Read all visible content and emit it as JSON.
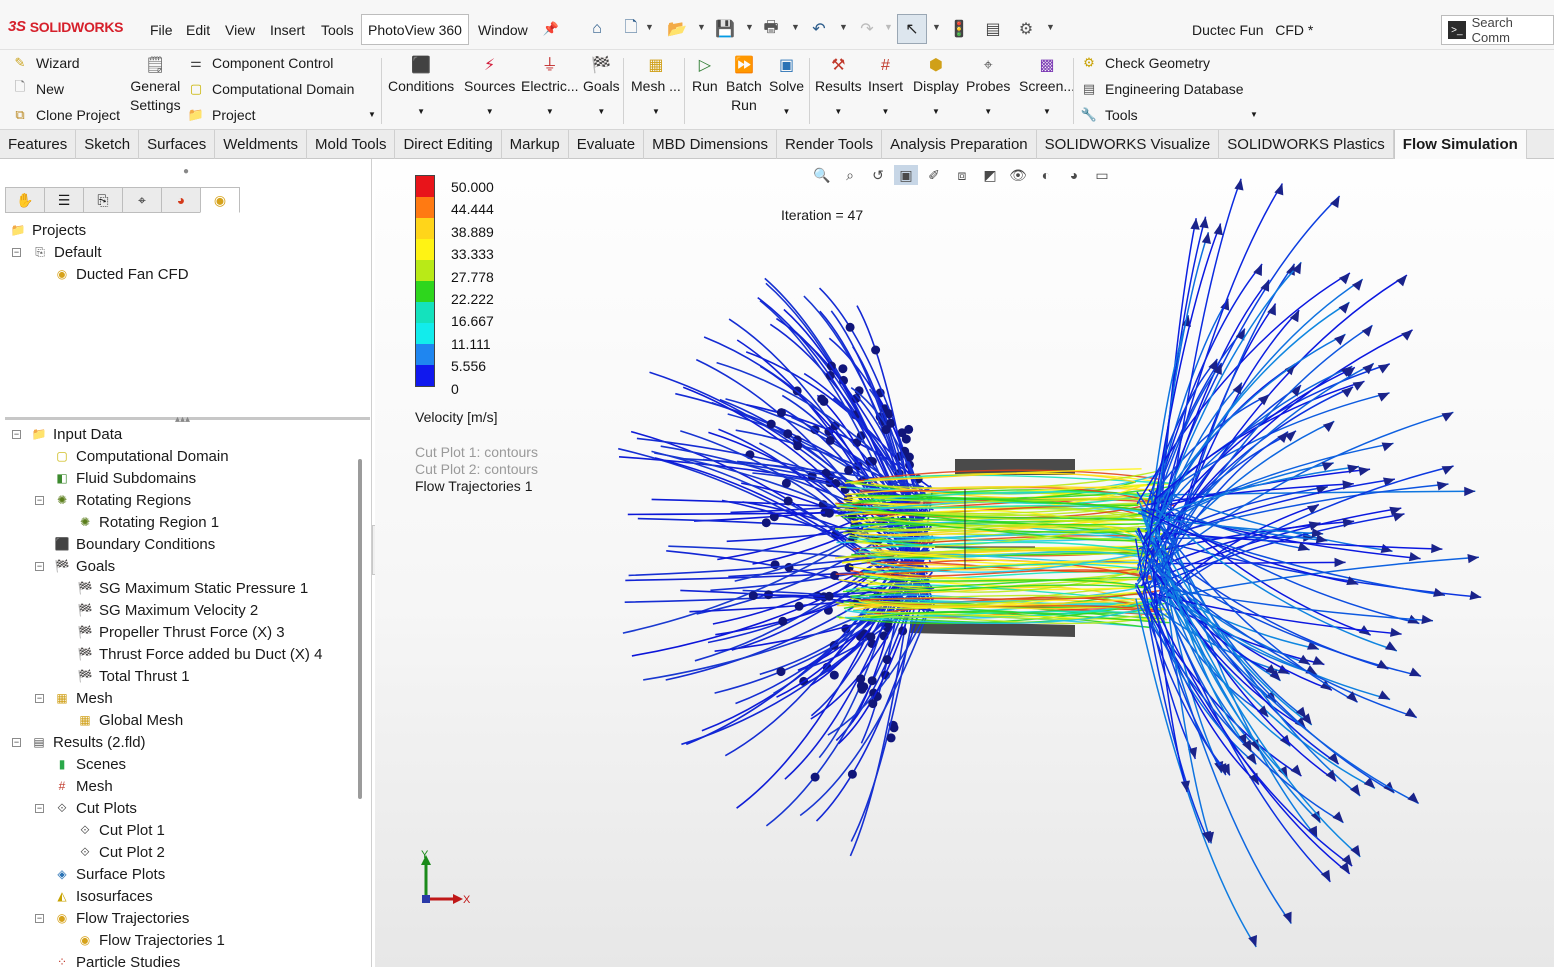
{
  "app": {
    "brand": "SOLIDWORKS",
    "document_title": "Ductec Fun   CFD *",
    "search_placeholder": "Search Comm"
  },
  "menu": {
    "items": [
      "File",
      "Edit",
      "View",
      "Insert",
      "Tools"
    ],
    "photoview": "PhotoView 360",
    "window": "Window"
  },
  "ribbon": {
    "left_col": [
      "Wizard",
      "New",
      "Clone Project"
    ],
    "general_settings": [
      "General",
      "Settings"
    ],
    "mid_col": [
      "Component Control",
      "Computational Domain",
      "Project"
    ],
    "big_buttons": [
      "Conditions",
      "Sources",
      "Electric...",
      "Goals",
      "Mesh ...",
      "Run",
      "Batch\nRun",
      "Solve",
      "Results",
      "Insert",
      "Display",
      "Probes",
      "Screen..."
    ],
    "batch_run": [
      "Batch",
      "Run"
    ],
    "right_col": [
      "Check Geometry",
      "Engineering Database",
      "Tools"
    ]
  },
  "tabs": [
    "Features",
    "Sketch",
    "Surfaces",
    "Weldments",
    "Mold Tools",
    "Direct Editing",
    "Markup",
    "Evaluate",
    "MBD Dimensions",
    "Render Tools",
    "Analysis Preparation",
    "SOLIDWORKS Visualize",
    "SOLIDWORKS Plastics",
    "Flow Simulation"
  ],
  "active_tab": "Flow Simulation",
  "project_tree": {
    "root": "Projects",
    "config": "Default",
    "project": "Ducted Fan CFD"
  },
  "analysis_tree": [
    {
      "label": "Input Data",
      "level": 0,
      "expander": "−",
      "icon": "folder-icon"
    },
    {
      "label": "Computational Domain",
      "level": 1,
      "icon": "domain-icon"
    },
    {
      "label": "Fluid Subdomains",
      "level": 1,
      "icon": "subdomain-icon"
    },
    {
      "label": "Rotating Regions",
      "level": 1,
      "expander": "−",
      "icon": "rotating-icon"
    },
    {
      "label": "Rotating Region 1",
      "level": 2,
      "icon": "rotating-icon"
    },
    {
      "label": "Boundary Conditions",
      "level": 1,
      "icon": "boundary-icon"
    },
    {
      "label": "Goals",
      "level": 1,
      "expander": "−",
      "icon": "goal-flag-icon"
    },
    {
      "label": "SG Maximum Static Pressure 1",
      "level": 2,
      "icon": "goal-flag-icon"
    },
    {
      "label": "SG Maximum Velocity 2",
      "level": 2,
      "icon": "goal-flag-icon"
    },
    {
      "label": "Propeller Thrust Force (X) 3",
      "level": 2,
      "icon": "goal-flag-icon"
    },
    {
      "label": "Thrust Force added bu Duct (X) 4",
      "level": 2,
      "icon": "goal-flag-icon"
    },
    {
      "label": "Total Thrust 1",
      "level": 2,
      "icon": "equation-goal-icon"
    },
    {
      "label": "Mesh",
      "level": 1,
      "expander": "−",
      "icon": "mesh-icon"
    },
    {
      "label": "Global Mesh",
      "level": 2,
      "icon": "mesh-icon"
    },
    {
      "label": "Results (2.fld)",
      "level": 0,
      "expander": "−",
      "icon": "results-icon"
    },
    {
      "label": "Scenes",
      "level": 1,
      "icon": "scenes-icon"
    },
    {
      "label": "Mesh",
      "level": 1,
      "icon": "grid-icon"
    },
    {
      "label": "Cut Plots",
      "level": 1,
      "expander": "−",
      "icon": "cut-plot-icon"
    },
    {
      "label": "Cut Plot 1",
      "level": 2,
      "icon": "cut-plot-icon"
    },
    {
      "label": "Cut Plot 2",
      "level": 2,
      "icon": "cut-plot-icon"
    },
    {
      "label": "Surface Plots",
      "level": 1,
      "icon": "surface-plot-icon"
    },
    {
      "label": "Isosurfaces",
      "level": 1,
      "icon": "isosurface-icon"
    },
    {
      "label": "Flow Trajectories",
      "level": 1,
      "expander": "−",
      "icon": "trajectory-icon"
    },
    {
      "label": "Flow Trajectories 1",
      "level": 2,
      "icon": "trajectory-icon"
    },
    {
      "label": "Particle Studies",
      "level": 1,
      "icon": "particle-icon"
    }
  ],
  "legend": {
    "values": [
      "50.000",
      "44.444",
      "38.889",
      "33.333",
      "27.778",
      "22.222",
      "16.667",
      "11.111",
      "5.556",
      "0"
    ],
    "colors": [
      "#e8141a",
      "#ff7a12",
      "#ffd51a",
      "#fff314",
      "#b9ea17",
      "#2ed61d",
      "#14e2bd",
      "#12ecec",
      "#1f86f0",
      "#1018ee"
    ],
    "title": "Velocity [m/s]"
  },
  "viewport": {
    "iteration": "Iteration = 47",
    "captions": [
      "Cut Plot 1: contours",
      "Cut Plot 2: contours",
      "Flow Trajectories 1"
    ],
    "axis_y": "Y",
    "axis_x": "X"
  }
}
